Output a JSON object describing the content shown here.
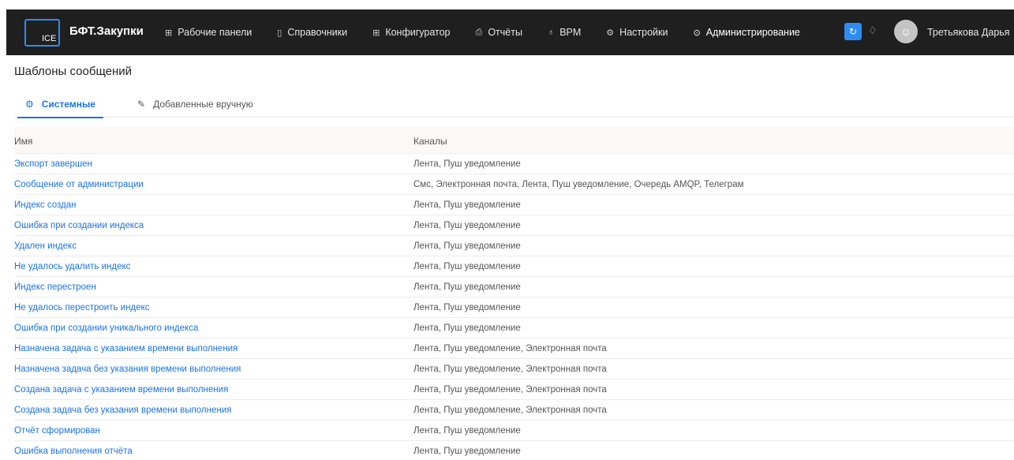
{
  "header": {
    "logo_text": "ICE",
    "brand": "БФТ.Закупки",
    "nav": [
      {
        "label": "Рабочие панели",
        "icon": "grid-icon"
      },
      {
        "label": "Справочники",
        "icon": "book-icon"
      },
      {
        "label": "Конфигуратор",
        "icon": "grid-icon"
      },
      {
        "label": "Отчёты",
        "icon": "printer-icon"
      },
      {
        "label": "BPM",
        "icon": "flowchart-icon"
      },
      {
        "label": "Настройки",
        "icon": "gear-icon"
      },
      {
        "label": "Администрирование",
        "icon": "shield-check-icon",
        "active": true
      }
    ],
    "user_name": "Третьякова Дарья"
  },
  "page": {
    "title": "Шаблоны сообщений",
    "tabs": [
      {
        "label": "Системные",
        "icon": "gear-icon",
        "active": true
      },
      {
        "label": "Добавленные вручную",
        "icon": "pencil-icon"
      }
    ]
  },
  "table": {
    "columns": [
      "Имя",
      "Каналы"
    ],
    "rows": [
      {
        "name": "Экспорт завершен",
        "channels": "Лента, Пуш уведомление"
      },
      {
        "name": "Сообщение от администрации",
        "channels": "Смс, Электронная почта, Лента, Пуш уведомление, Очередь AMQP, Телеграм"
      },
      {
        "name": "Индекс создан",
        "channels": "Лента, Пуш уведомление"
      },
      {
        "name": "Ошибка при создании индекса",
        "channels": "Лента, Пуш уведомление"
      },
      {
        "name": "Удален индекс",
        "channels": "Лента, Пуш уведомление"
      },
      {
        "name": "Не удалось удалить индекс",
        "channels": "Лента, Пуш уведомление"
      },
      {
        "name": "Индекс перестроен",
        "channels": "Лента, Пуш уведомление"
      },
      {
        "name": "Не удалось перестроить индекс",
        "channels": "Лента, Пуш уведомление"
      },
      {
        "name": "Ошибка при создании уникального индекса",
        "channels": "Лента, Пуш уведомление"
      },
      {
        "name": "Назначена задача с указанием времени выполнения",
        "channels": "Лента, Пуш уведомление, Электронная почта"
      },
      {
        "name": "Назначена задача без указания времени выполнения",
        "channels": "Лента, Пуш уведомление, Электронная почта"
      },
      {
        "name": "Создана задача с указанием времени выполнения",
        "channels": "Лента, Пуш уведомление, Электронная почта"
      },
      {
        "name": "Создана задача без указания времени выполнения",
        "channels": "Лента, Пуш уведомление, Электронная почта"
      },
      {
        "name": "Отчёт сформирован",
        "channels": "Лента, Пуш уведомление"
      },
      {
        "name": "Ошибка выполнения отчёта",
        "channels": "Лента, Пуш уведомление"
      }
    ]
  }
}
